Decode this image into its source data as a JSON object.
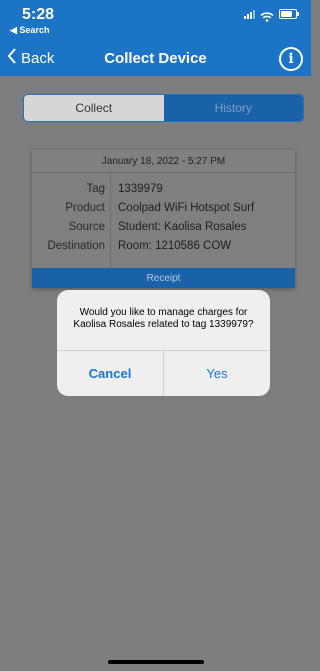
{
  "status_bar": {
    "time": "5:28",
    "back_app": "◀ Search"
  },
  "nav": {
    "back_label": "Back",
    "title": "Collect Device",
    "info_icon": "info-icon"
  },
  "tabs": [
    {
      "label": "Collect",
      "selected": true
    },
    {
      "label": "History",
      "selected": false
    }
  ],
  "record": {
    "date": "January 18, 2022 - 5:27 PM",
    "fields": [
      {
        "label": "Tag",
        "value": "1339979"
      },
      {
        "label": "Product",
        "value": "Coolpad WiFi Hotspot Surf"
      },
      {
        "label": "Source",
        "value": "Student: Kaolisa Rosales"
      },
      {
        "label": "Destination",
        "value": "Room: 1210586 COW"
      }
    ],
    "receipt_label": "Receipt"
  },
  "alert": {
    "message": "Would you like to manage charges for Kaolisa Rosales related to tag 1339979?",
    "cancel_label": "Cancel",
    "confirm_label": "Yes"
  },
  "colors": {
    "accent": "#1c74c7",
    "alert_button": "#1a73d9"
  }
}
